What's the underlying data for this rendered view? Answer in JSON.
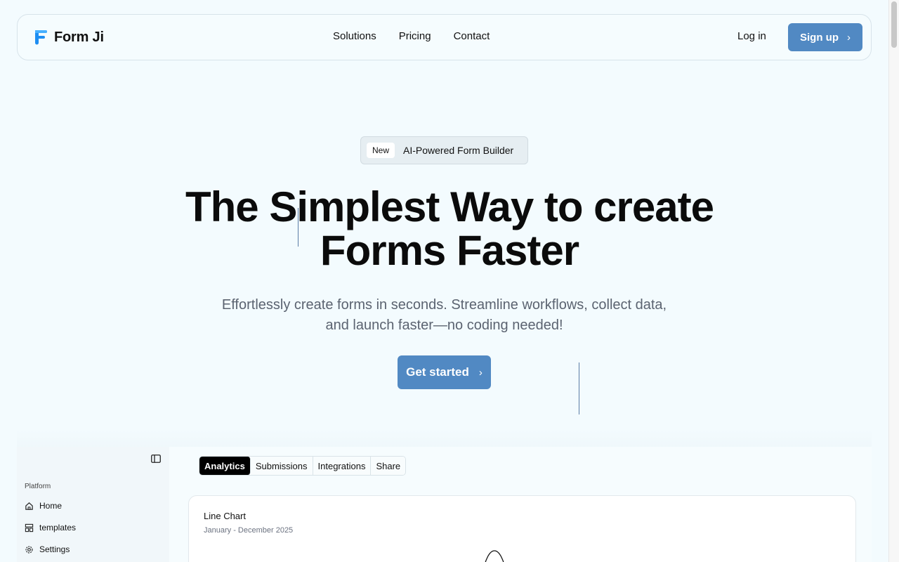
{
  "brand": {
    "name": "Form Ji",
    "logo_color": "#1e8ef2"
  },
  "nav": {
    "links": [
      "Solutions",
      "Pricing",
      "Contact"
    ],
    "login": "Log in",
    "signup": "Sign up"
  },
  "hero": {
    "badge_tag": "New",
    "badge_text": "AI-Powered Form Builder",
    "headline_line1": "The Simplest Way to create",
    "headline_line2": "Forms Faster",
    "subhead_line1": "Effortlessly create forms in seconds. Streamline workflows, collect data,",
    "subhead_line2": "and launch faster—no coding needed!",
    "cta": "Get started"
  },
  "sidebar": {
    "group_label": "Platform",
    "items": [
      {
        "label": "Home",
        "icon": "home-icon"
      },
      {
        "label": "templates",
        "icon": "layout-icon"
      },
      {
        "label": "Settings",
        "icon": "gear-icon"
      }
    ]
  },
  "tabs": [
    "Analytics",
    "Submissions",
    "Integrations",
    "Share"
  ],
  "active_tab": "Analytics",
  "card": {
    "title": "Line Chart",
    "subtitle": "January - December 2025"
  },
  "colors": {
    "accent": "#5189c3",
    "background": "#f3fbfe"
  }
}
